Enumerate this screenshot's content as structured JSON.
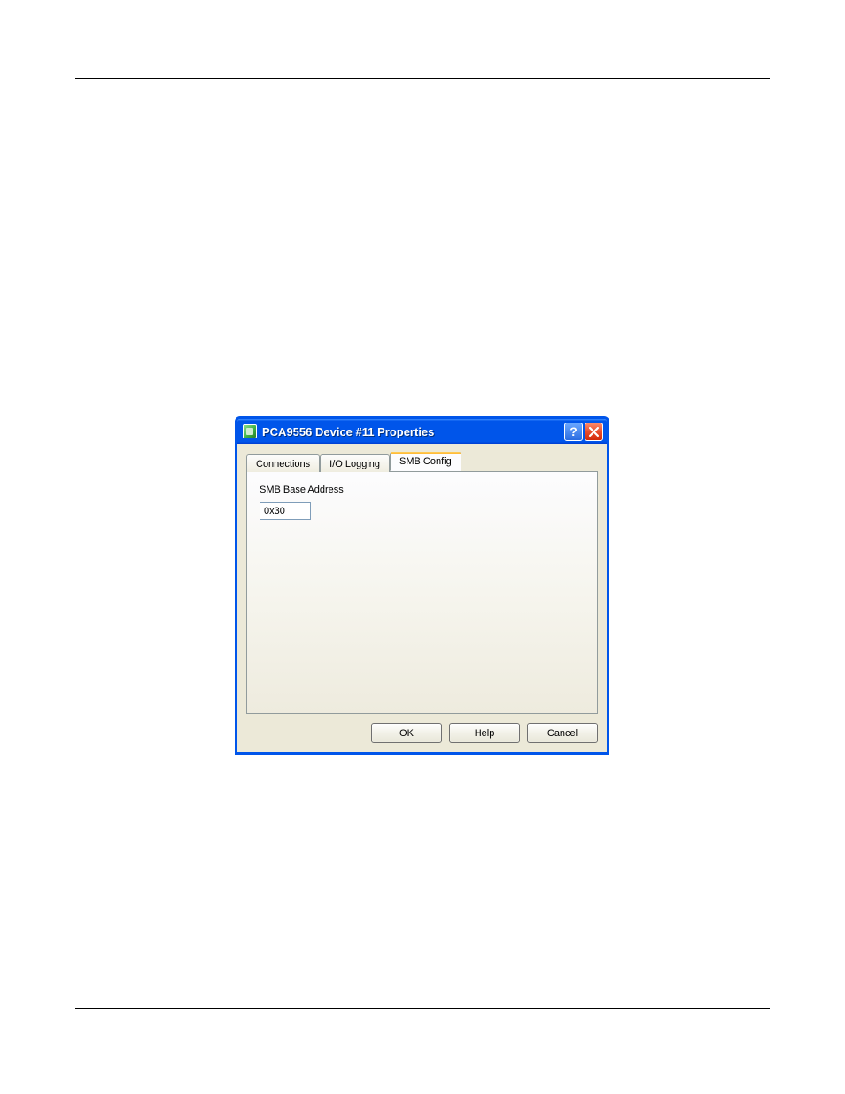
{
  "dialog": {
    "title": "PCA9556 Device #11 Properties",
    "tabs": [
      {
        "label": "Connections",
        "active": false
      },
      {
        "label": "I/O Logging",
        "active": false
      },
      {
        "label": "SMB Config",
        "active": true
      }
    ],
    "smb_config": {
      "field_label": "SMB Base Address",
      "value": "0x30"
    },
    "buttons": {
      "ok": "OK",
      "help": "Help",
      "cancel": "Cancel"
    },
    "titlebar_help": "?",
    "titlebar_close": "×"
  }
}
